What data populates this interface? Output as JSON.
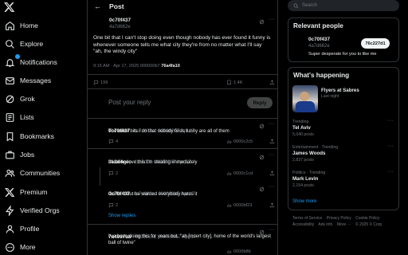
{
  "nav": {
    "items": [
      {
        "label": "Home",
        "icon": "home-icon"
      },
      {
        "label": "Explore",
        "icon": "search-icon"
      },
      {
        "label": "Notifications",
        "icon": "bell-icon"
      },
      {
        "label": "Messages",
        "icon": "mail-icon"
      },
      {
        "label": "Grok",
        "icon": "grok-icon"
      },
      {
        "label": "Lists",
        "icon": "list-icon"
      },
      {
        "label": "Bookmarks",
        "icon": "bookmark-icon"
      },
      {
        "label": "Jobs",
        "icon": "briefcase-icon"
      },
      {
        "label": "Communities",
        "icon": "people-icon"
      },
      {
        "label": "Premium",
        "icon": "x-logo-icon"
      },
      {
        "label": "Verified Orgs",
        "icon": "lightning-icon"
      },
      {
        "label": "Profile",
        "icon": "person-icon"
      },
      {
        "label": "More",
        "icon": "more-circle-icon"
      }
    ]
  },
  "header": {
    "title": "Post"
  },
  "post": {
    "name": "0c70f437",
    "handle": "4a7d662e",
    "text": "One bit that I can't stop doing even though nobody has ever found it funny is whenever someone tells me what city they're from no matter what I'll say \"ah, the windy city\"",
    "time": "9:15 AM · Apr 17, 2025 000000b7",
    "views": "76a4fa10",
    "replies": "199",
    "bookmarks": "1.4K"
  },
  "reply_box": {
    "placeholder": "Post your reply",
    "button": "Reply"
  },
  "replies": [
    {
      "name": "0c70f437",
      "handle": "4a7d662e",
      "date": "000000b7 Apr 17",
      "text": "The other bits I do that nobody finds funny are all of them",
      "comments": "4",
      "views": "0000c2c5"
    },
    {
      "name": "3e3d4cec",
      "handle": "f1b8d2f",
      "date": "000000b7 Apr 17",
      "text": "I fucking love this I'm stealing immediately",
      "comments": "2",
      "views": "0000c1cd"
    },
    {
      "name": "0c70f437",
      "handle": "4a7d662e",
      "date": "000000b7 Apr 17",
      "text": "Go for it but be warned everybody hates it",
      "comments": "2",
      "views": "0000bf23"
    },
    {
      "name": "7a4937ab",
      "handle": "4b93b131",
      "date": "000000b7 Apr 17",
      "text": "I've been doing this for years but, \"ah [insert city], home of the world's largest ball of twine\"",
      "comments": "",
      "views": "0000b8b"
    }
  ],
  "show_replies": "Show replies",
  "search": {
    "placeholder": "Search"
  },
  "relevant": {
    "title": "Relevant people",
    "name": "0c70f437",
    "handle": "4a7d662e",
    "follow": "76c227d1",
    "bio": "Super desperate for you to like me"
  },
  "happening": {
    "title": "What's happening",
    "event_title": "Flyers at Sabres",
    "event_status": "Last night",
    "trends": [
      {
        "context": "Trending",
        "title": "Tel Aviv",
        "count": "5,040 posts"
      },
      {
        "context": "Entertainment · Trending",
        "title": "James Woods",
        "count": "2,837 posts"
      },
      {
        "context": "Politics · Trending",
        "title": "Mark Levin",
        "count": "2,154 posts"
      }
    ],
    "show_more": "Show more"
  },
  "footer": {
    "links": [
      "Terms of Service",
      "Privacy Policy",
      "Cookie Policy",
      "Accessibility",
      "Ads info",
      "More ···",
      "© 2025 X Corp."
    ]
  },
  "colors": {
    "accent": "#1d9bf0",
    "background": "#000000",
    "border": "#2f3336",
    "muted": "#71767b"
  }
}
